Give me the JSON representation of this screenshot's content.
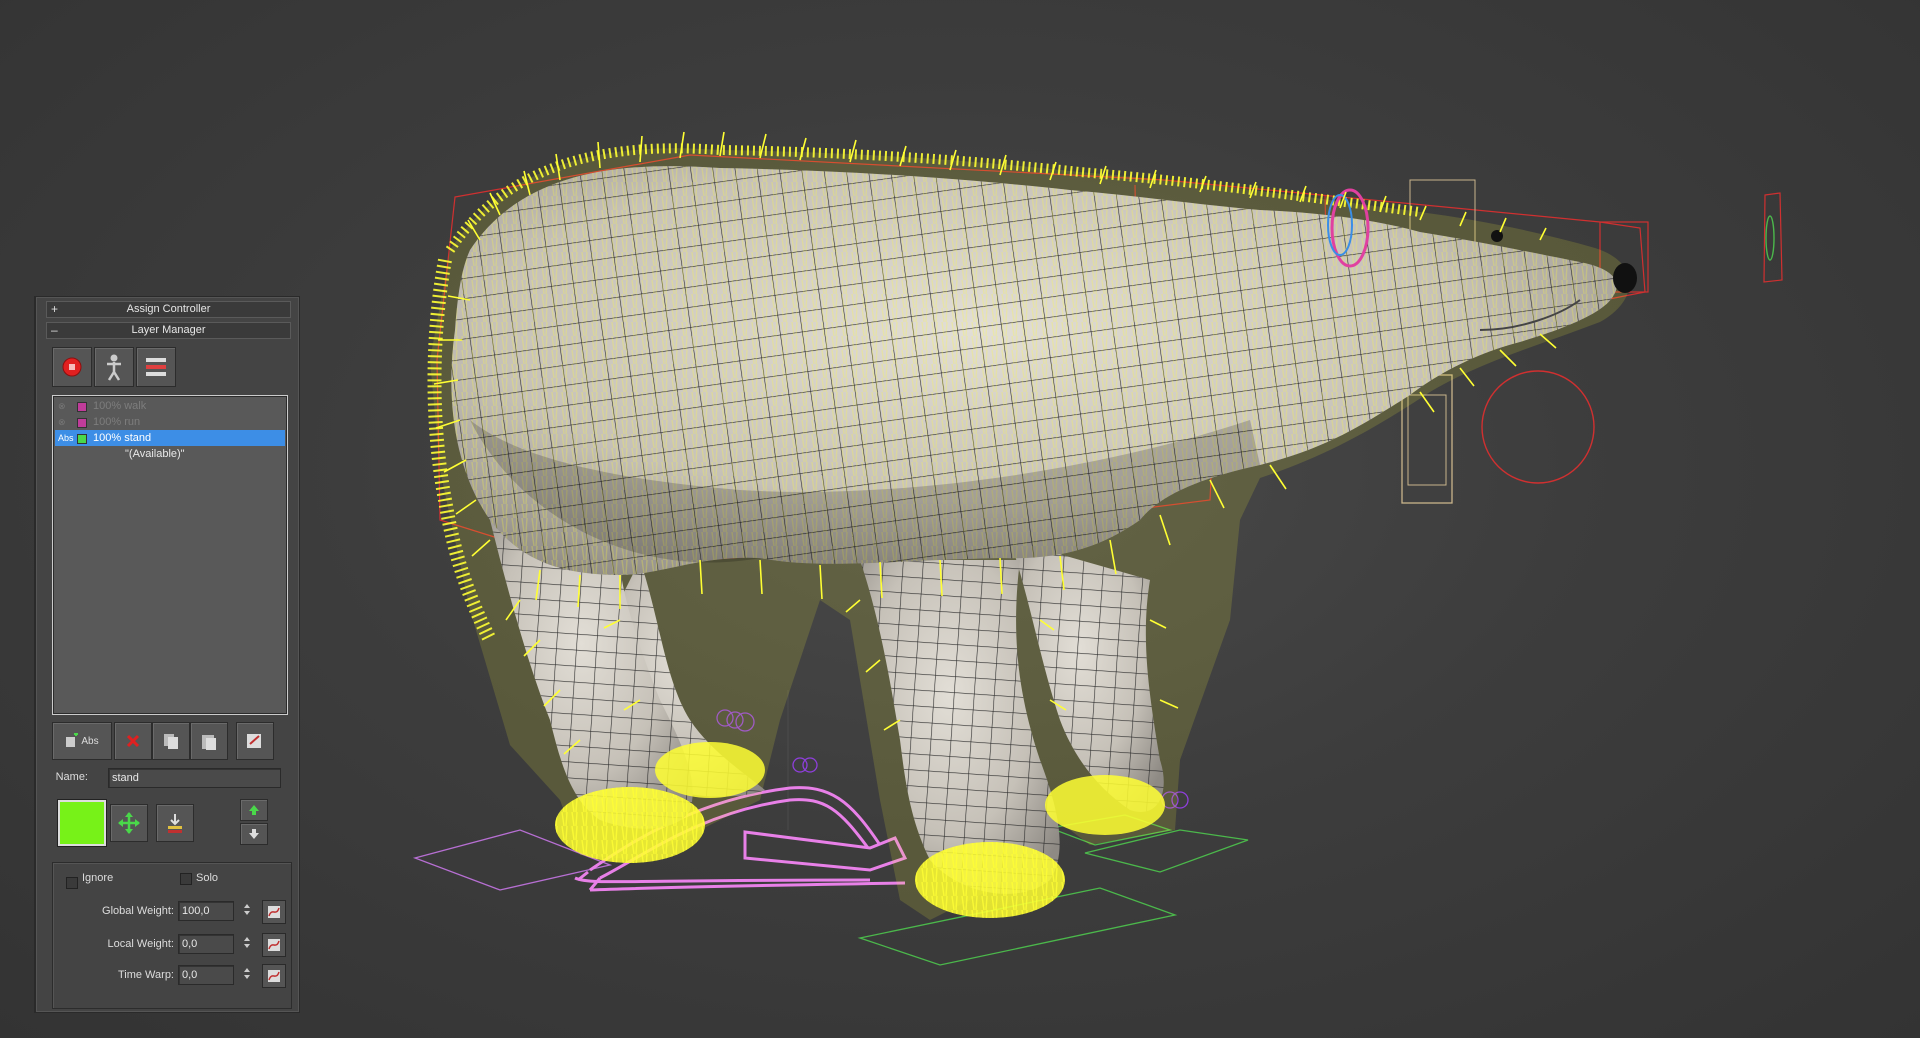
{
  "colors": {
    "fur": "#ffff33",
    "wire": "#2b2b2b",
    "body": "#cfcbc3",
    "bbox": "#d03030",
    "selection": "#3d8ee6",
    "layer_color": "#77f218",
    "path": "#e880e8",
    "ground_green": "#4bb84b"
  },
  "panel": {
    "rollout_assign": {
      "label": "Assign Controller",
      "state": "+"
    },
    "rollout_layers": {
      "label": "Layer Manager",
      "state": "–"
    },
    "layers": [
      {
        "tag": "",
        "name": "100% walk",
        "swatch": "#c03c9a",
        "selected": false
      },
      {
        "tag": "",
        "name": "100% run",
        "swatch": "#c03c9a",
        "selected": false
      },
      {
        "tag": "Abs",
        "name": "100% stand",
        "swatch": "#4ad84a",
        "selected": true
      }
    ],
    "available": "\"(Available)\"",
    "new_layer_tag": "Abs",
    "name_label": "Name:",
    "name_value": "stand",
    "ignore_label": "Ignore",
    "solo_label": "Solo",
    "global_weight_label": "Global Weight:",
    "global_weight_value": "100,0",
    "local_weight_label": "Local Weight:",
    "local_weight_value": "0,0",
    "time_warp_label": "Time Warp:",
    "time_warp_value": "0,0"
  }
}
